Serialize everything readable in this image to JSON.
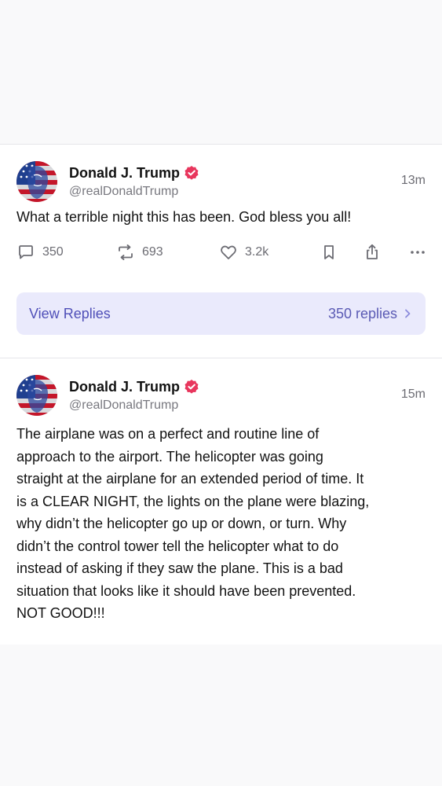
{
  "posts": [
    {
      "author": {
        "name": "Donald J. Trump",
        "handle": "@realDonaldTrump",
        "verified": true
      },
      "time": "13m",
      "text": "What a terrible night this has been. God bless you all!",
      "stats": {
        "replies": "350",
        "retruths": "693",
        "likes": "3.2k"
      },
      "view_replies": {
        "label": "View Replies",
        "count_label": "350 replies"
      }
    },
    {
      "author": {
        "name": "Donald J. Trump",
        "handle": "@realDonaldTrump",
        "verified": true
      },
      "time": "15m",
      "text_lines": [
        "The airplane was on a perfect and routine line of",
        "approach to the airport. The helicopter was going",
        "straight at the airplane for an extended period of time. It",
        "is a CLEAR NIGHT, the lights on the plane were blazing,",
        "why didn’t the helicopter go up or down, or turn. Why",
        "didn’t the control tower tell the helicopter what to do",
        "instead of asking if they saw the plane. This is a bad",
        "situation that looks like it should have been prevented.",
        "NOT GOOD!!!"
      ]
    }
  ],
  "icons": {
    "reply": "speech-bubble-icon",
    "retruth": "retruth-arrows-icon",
    "like": "heart-icon",
    "bookmark": "bookmark-icon",
    "share": "share-icon",
    "more": "more-dots-icon",
    "verified": "verified-badge-icon",
    "chevron": "chevron-right-icon"
  },
  "colors": {
    "verified_badge": "#e8365d",
    "accent": "#5b5bd6",
    "view_replies_bg": "#eaeafc",
    "muted_text": "#6c6c73"
  }
}
